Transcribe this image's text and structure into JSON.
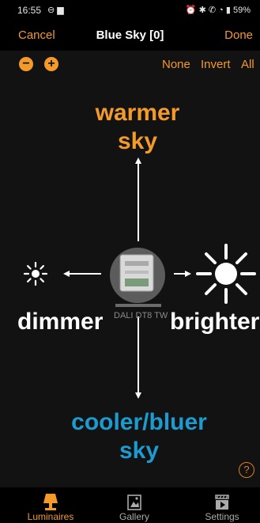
{
  "status": {
    "time": "16:55",
    "battery": "59%"
  },
  "nav": {
    "cancel": "Cancel",
    "title": "Blue Sky [0]",
    "done": "Done"
  },
  "selection": {
    "none": "None",
    "invert": "Invert",
    "all": "All"
  },
  "labels": {
    "warmer": "warmer\nsky",
    "cooler": "cooler/bluer\nsky",
    "dimmer": "dimmer",
    "brighter": "brighter",
    "device": "DALI DT8 TW"
  },
  "tabs": {
    "luminaires": "Luminaires",
    "gallery": "Gallery",
    "settings": "Settings"
  },
  "colors": {
    "accent": "#f39a2b",
    "blue": "#1d9bd1"
  },
  "icons": [
    "minus-icon",
    "plus-icon",
    "sun-small-icon",
    "sun-large-icon",
    "device-icon",
    "help-icon",
    "lamp-icon",
    "gallery-icon",
    "clapper-icon"
  ]
}
